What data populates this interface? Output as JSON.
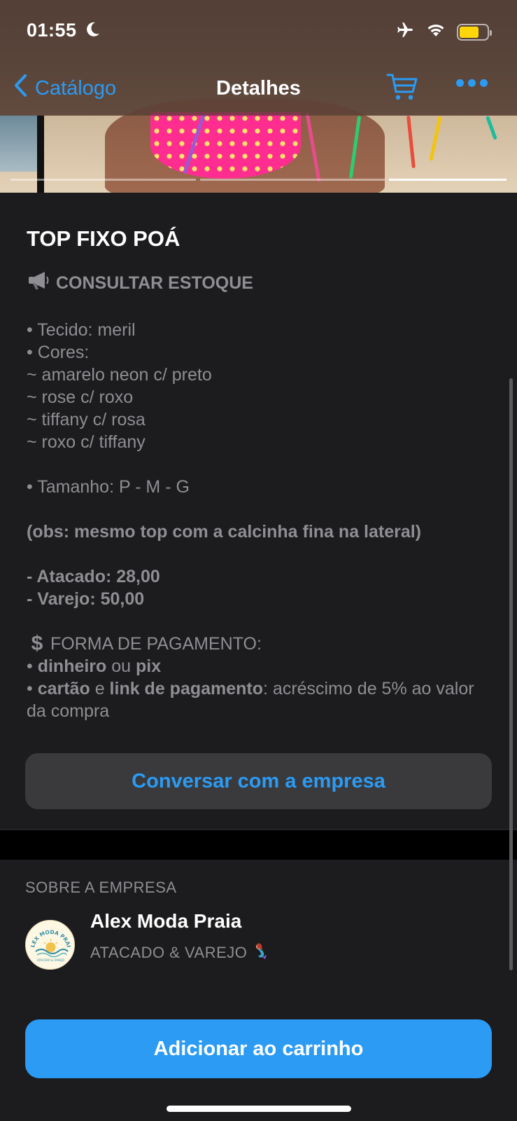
{
  "status_bar": {
    "time": "01:55"
  },
  "nav": {
    "back_label": "Catálogo",
    "title": "Detalhes"
  },
  "product": {
    "name": "TOP FIXO POÁ",
    "stock_notice": "CONSULTAR ESTOQUE",
    "fabric": "• Tecido: meril",
    "colors_heading": "• Cores:",
    "colors": [
      "~ amarelo neon c/ preto",
      "~ rose c/ roxo",
      "~ tiffany c/ rosa",
      "~ roxo c/ tiffany"
    ],
    "sizes": "• Tamanho: P - M - G",
    "note": "(obs: mesmo top com a calcinha fina na lateral)",
    "price_wholesale": "- Atacado: 28,00",
    "price_retail": "- Varejo: 50,00",
    "payment_heading": "FORMA DE PAGAMENTO:",
    "payment_line1": {
      "bullet": "• ",
      "a": "dinheiro",
      "mid": " ou ",
      "b": "pix"
    },
    "payment_line2": {
      "bullet": "• ",
      "a": "cartão",
      "mid": " e ",
      "b": "link de pagamento",
      "rest": ": acréscimo de 5% ao valor da compra"
    }
  },
  "buttons": {
    "chat": "Conversar com a empresa",
    "add_to_cart": "Adicionar ao carrinho"
  },
  "about": {
    "label": "SOBRE A EMPRESA",
    "company_name": "Alex Moda Praia",
    "tagline": "ATACADO & VAREJO",
    "logo_text": "ALEX MODA PRAIA",
    "logo_subtext": "ATACADO & VAREJO"
  },
  "colors": {
    "accent": "#2b9bf4",
    "battery": "#ffd60a",
    "background": "#1c1c1e"
  },
  "icons": [
    "moon-icon",
    "airplane-icon",
    "wifi-icon",
    "battery-icon",
    "chevron-left-icon",
    "cart-icon",
    "more-icon",
    "megaphone-icon",
    "dollar-icon",
    "mermaid-icon"
  ]
}
